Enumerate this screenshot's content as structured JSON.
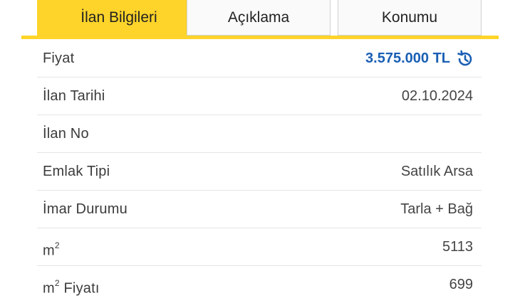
{
  "tabs": [
    {
      "label": "İlan Bilgileri",
      "active": true
    },
    {
      "label": "Açıklama",
      "active": false
    },
    {
      "label": "Konumu",
      "active": false
    }
  ],
  "colors": {
    "accent": "#ffd42a",
    "price": "#1a5fb4"
  },
  "rows": {
    "price": {
      "label": "Fiyat",
      "value": "3.575.000 TL",
      "icon": "price-history-icon"
    },
    "date": {
      "label": "İlan Tarihi",
      "value": "02.10.2024"
    },
    "no": {
      "label": "İlan No",
      "value": ""
    },
    "type": {
      "label": "Emlak Tipi",
      "value": "Satılık Arsa"
    },
    "zoning": {
      "label": "İmar Durumu",
      "value": "Tarla + Bağ"
    },
    "area": {
      "label": "m",
      "label_sup": "2",
      "value": "5113"
    },
    "unit_price": {
      "label": "m",
      "label_sup": "2",
      "label_suffix": " Fiyatı",
      "value": "699"
    }
  }
}
